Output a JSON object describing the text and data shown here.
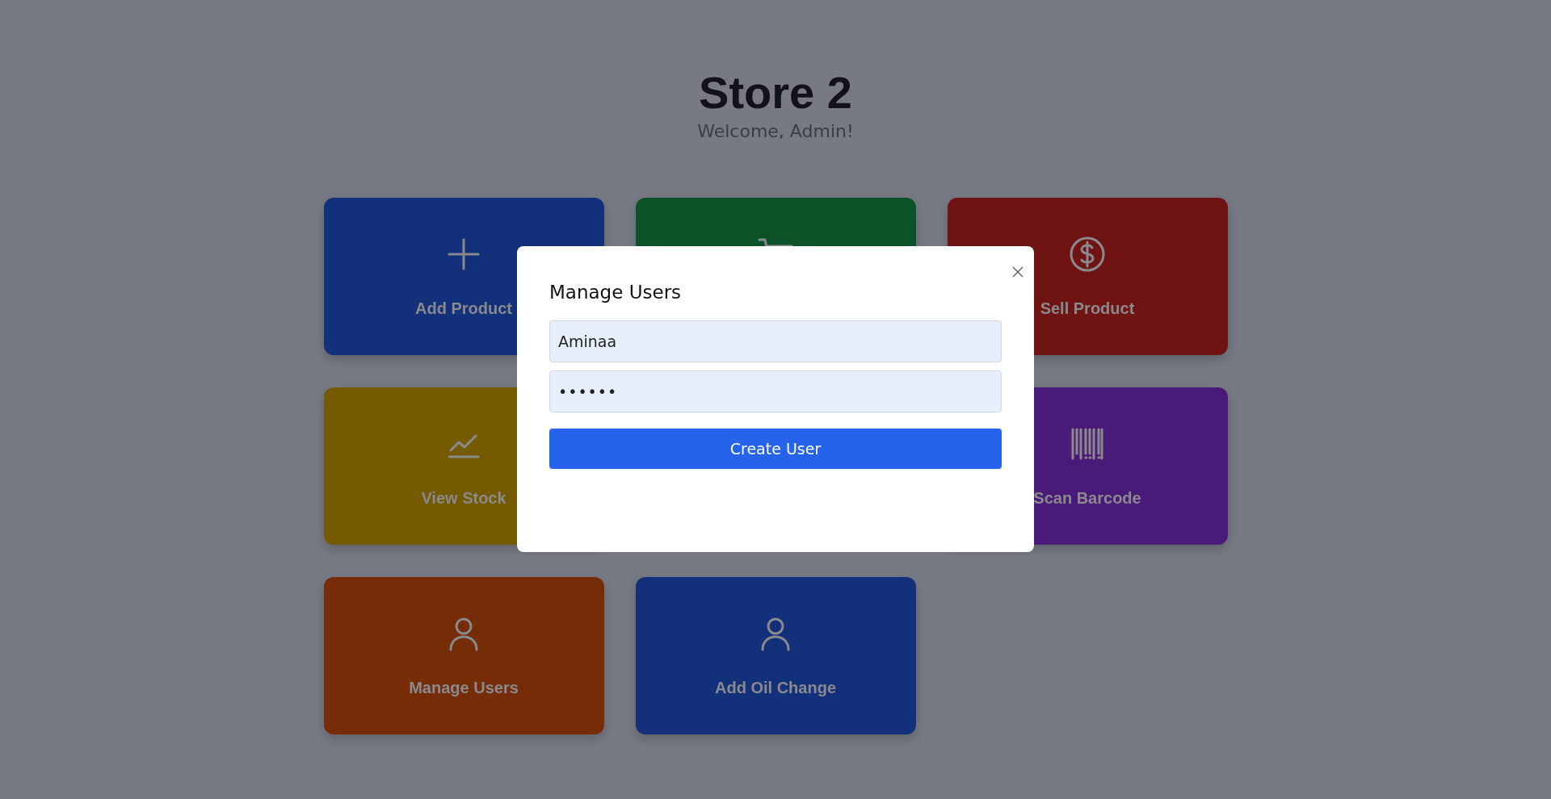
{
  "header": {
    "title": "Store 2",
    "subtitle": "Welcome, Admin!"
  },
  "cards": [
    {
      "label": "Add Product",
      "color": "#12317a"
    },
    {
      "color": "#0b5228"
    },
    {
      "label": "Sell Product",
      "color": "#6f1313"
    },
    {
      "label": "View Stock",
      "color": "#765a02"
    },
    {
      "label": "Scan Barcode",
      "color": "#4a1a78"
    },
    {
      "label": "Manage Users",
      "color": "#772c08"
    },
    {
      "label": "Add Oil Change",
      "color": "#12317a"
    }
  ],
  "modal": {
    "title": "Manage Users",
    "fields": [
      {
        "kind": "text",
        "value": "Aminaa"
      },
      {
        "kind": "password",
        "value": "••••••"
      }
    ],
    "button": "Create User"
  }
}
